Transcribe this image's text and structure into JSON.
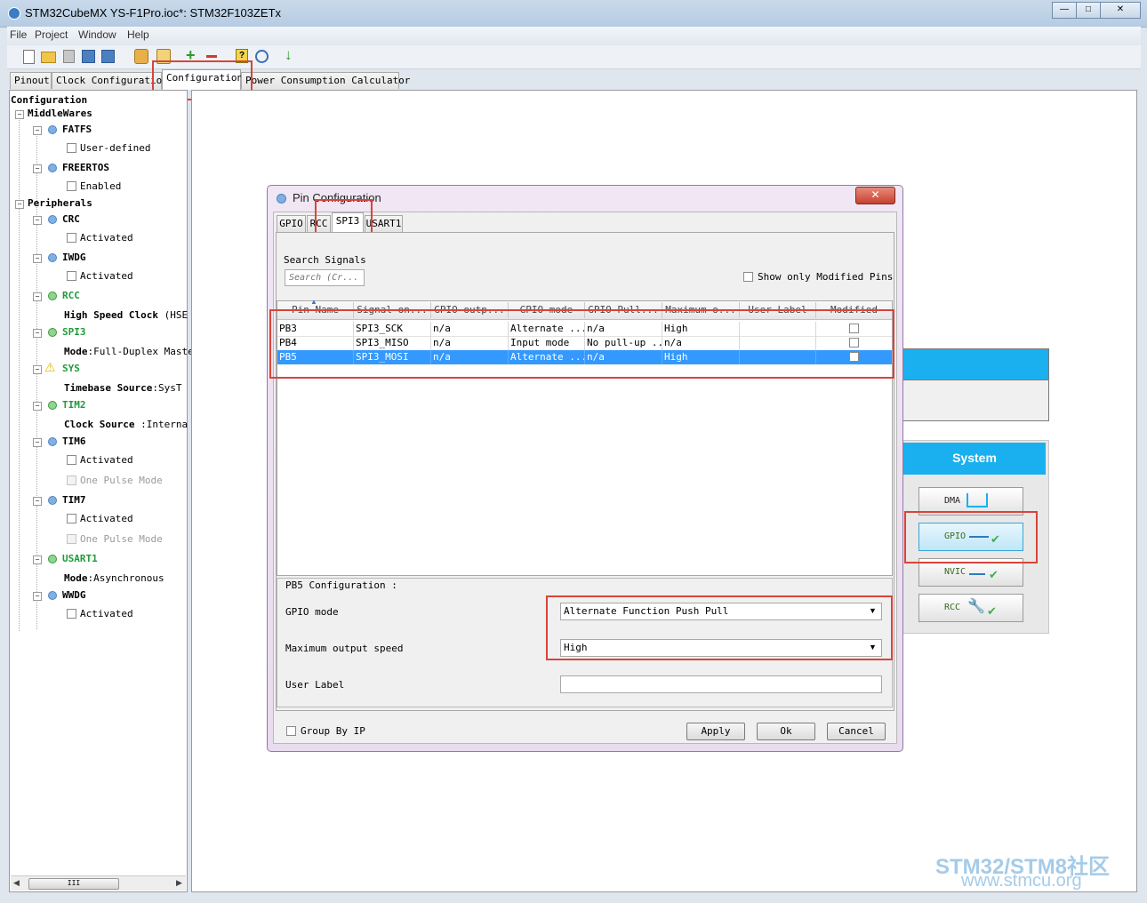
{
  "window": {
    "title": "STM32CubeMX YS-F1Pro.ioc*: STM32F103ZETx",
    "controls": [
      "—",
      "□",
      "✕"
    ]
  },
  "menu": [
    "File",
    "Project",
    "Window",
    "Help"
  ],
  "tabs": [
    "Pinout",
    "Clock Configuration",
    "Configuration",
    "Power Consumption Calculator"
  ],
  "tree": {
    "root": "Configuration",
    "middlewares": "MiddleWares",
    "fatfs": "FATFS",
    "fatfs_opt": "User-defined",
    "freertos": "FREERTOS",
    "freertos_opt": "Enabled",
    "peripherals": "Peripherals",
    "crc": "CRC",
    "crc_opt": "Activated",
    "iwdg": "IWDG",
    "iwdg_opt": "Activated",
    "rcc": "RCC",
    "rcc_key": "High Speed Clock",
    "rcc_val": "(HSE",
    "spi3": "SPI3",
    "spi3_key": "Mode",
    "spi3_val": ":Full-Duplex Maste",
    "sys": "SYS",
    "sys_key": "Timebase Source",
    "sys_val": ":SysT",
    "tim2": "TIM2",
    "tim2_key": "Clock Source",
    "tim2_val": " :Interna",
    "tim6": "TIM6",
    "tim6_opt1": "Activated",
    "tim6_opt2": "One Pulse Mode",
    "tim7": "TIM7",
    "tim7_opt1": "Activated",
    "tim7_opt2": "One Pulse Mode",
    "usart1": "USART1",
    "usart1_key": "Mode",
    "usart1_val": ":Asynchronous",
    "wwdg": "WWDG",
    "wwdg_opt": "Activated",
    "hscroll_grip": "III"
  },
  "dialog": {
    "title": "Pin Configuration",
    "tabs": [
      "GPIO",
      "RCC",
      "SPI3",
      "USART1"
    ],
    "search_label": "Search Signals",
    "search_placeholder": "Search (Cr...",
    "show_modified": "Show only Modified Pins",
    "columns": [
      "Pin Name",
      "Signal on...",
      "GPIO outp...",
      "GPIO mode",
      "GPIO Pull...",
      "Maximum o...",
      "User Label",
      "Modified"
    ],
    "rows": [
      [
        "PB3",
        "SPI3_SCK",
        "n/a",
        "Alternate ...",
        "n/a",
        "High",
        ""
      ],
      [
        "PB4",
        "SPI3_MISO",
        "n/a",
        "Input mode",
        "No pull-up ...",
        "n/a",
        ""
      ],
      [
        "PB5",
        "SPI3_MOSI",
        "n/a",
        "Alternate ...",
        "n/a",
        "High",
        ""
      ]
    ],
    "selected_row": 2,
    "config_title": "PB5 Configuration :",
    "gpio_mode_label": "GPIO mode",
    "gpio_mode_value": "Alternate Function Push Pull",
    "speed_label": "Maximum output speed",
    "speed_value": "High",
    "user_label": "User Label",
    "group_by_ip": "Group By IP",
    "buttons": {
      "apply": "Apply",
      "ok": "Ok",
      "cancel": "Cancel"
    }
  },
  "system_panel": {
    "title": "System",
    "buttons": [
      "DMA",
      "GPIO",
      "NVIC",
      "RCC"
    ]
  },
  "watermark": {
    "line1": "STM32/STM8社区",
    "line2": "www.stmcu.org"
  },
  "colors": {
    "accent": "#1ab0ef",
    "selection": "#3399ff",
    "highlight": "#d9443a"
  }
}
